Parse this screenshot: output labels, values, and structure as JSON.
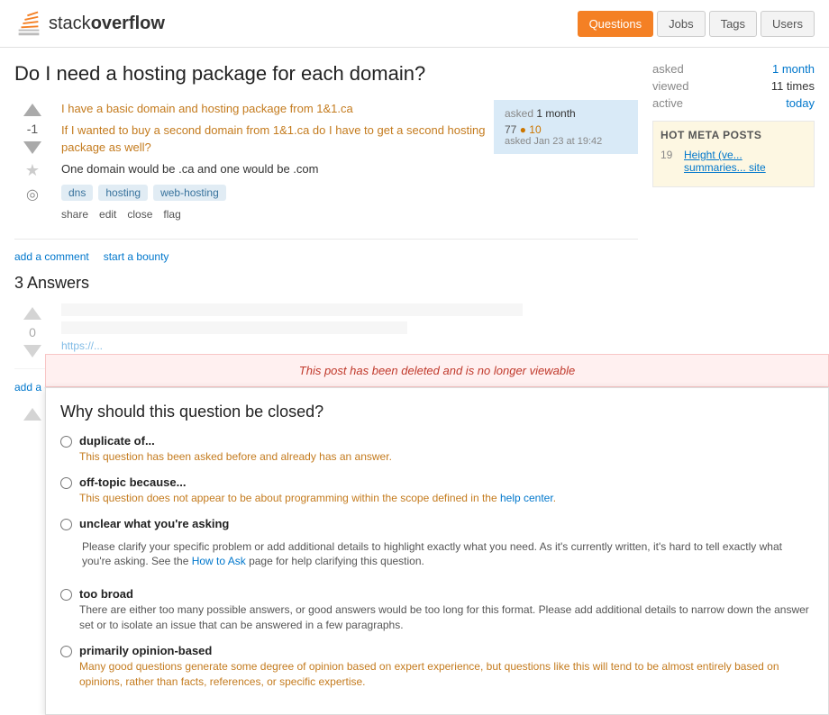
{
  "header": {
    "logo_stack": "stack",
    "logo_overflow": "overflow",
    "nav": [
      "Questions",
      "Jobs",
      "Tags",
      "Users"
    ],
    "nav_active": 0
  },
  "page": {
    "title": "Do I need a hosting package for each domain?"
  },
  "question": {
    "vote_count": "-1",
    "lines": [
      "I have a basic domain and hosting package from 1&1.ca",
      "If I wanted to buy a second domain from 1&1.ca do I have to get a second hosting package as well?",
      "One domain would be .ca and one would be .com"
    ],
    "tags": [
      "dns",
      "hosting",
      "web-hosting"
    ],
    "actions": [
      "share",
      "edit",
      "close",
      "flag"
    ],
    "asked_date": "asked Jan 23 at 19:42",
    "asker_rep": "77",
    "asker_badge": "● 10"
  },
  "stats": {
    "asked_label": "asked",
    "asked_value": "1 month",
    "viewed_label": "viewed",
    "viewed_value": "11 times",
    "active_label": "active",
    "active_value": "today"
  },
  "answers": {
    "title": "3 Answers",
    "add_comment": "add a comment",
    "start_bounty": "start a bounty"
  },
  "hot_meta": {
    "title": "HOT META POSTS",
    "count": "19",
    "link_text": "Height (ve... summaries... site"
  },
  "deleted_banner": {
    "text": "This post has been deleted and is no longer viewable"
  },
  "close_dialog": {
    "title": "Why should this question be closed?",
    "options": [
      {
        "id": "duplicate",
        "label": "duplicate of...",
        "desc": "This question has been asked before and already has an answer.",
        "color": "orange"
      },
      {
        "id": "off-topic",
        "label": "off-topic because...",
        "desc": "This question does not appear to be about programming within the scope defined in the ",
        "link": "help center",
        "desc2": ".",
        "color": "orange"
      },
      {
        "id": "unclear",
        "label": "unclear what you're asking",
        "desc": "Please clarify your specific problem or add additional details to highlight exactly what you need. As it's currently written, it's hard to tell exactly what you're asking. See the ",
        "link": "How to Ask",
        "desc2": " page for help clarifying this question.",
        "color": "gray"
      },
      {
        "id": "too-broad",
        "label": "too broad",
        "desc": "There are either too many possible answers, or good answers would be too long for this format. Please add additional details to narrow down the answer set or to isolate an issue that can be answered in a few paragraphs.",
        "color": "gray"
      },
      {
        "id": "opinion",
        "label": "primarily opinion-based",
        "desc": "Many good questions generate some degree of opinion based on expert experience, but questions like this will tend to be almost entirely based on opinions, rather than facts, references, or specific expertise.",
        "color": "orange"
      }
    ]
  }
}
